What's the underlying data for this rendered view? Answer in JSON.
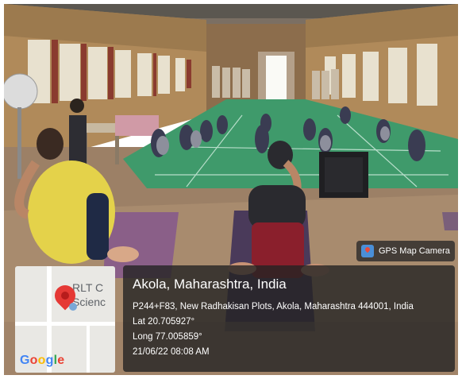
{
  "watermark": {
    "badge_label": "GPS Map Camera",
    "icon": "gps-map-camera-logo-icon"
  },
  "location": {
    "title": "Akola, Maharashtra, India",
    "address": "P244+F83, New Radhakisan Plots, Akola, Maharashtra 444001, India",
    "lat": "Lat 20.705927°",
    "long": "Long 77.005859°",
    "datetime": "21/06/22 08:08 AM"
  },
  "map_thumbnail": {
    "place_label": "RLT C\nScienc",
    "logo": "Google",
    "pin_icon": "map-pin-icon",
    "logo_colors": [
      "#4285F4",
      "#EA4335",
      "#FBBC05",
      "#4285F4",
      "#34A853",
      "#EA4335"
    ]
  }
}
